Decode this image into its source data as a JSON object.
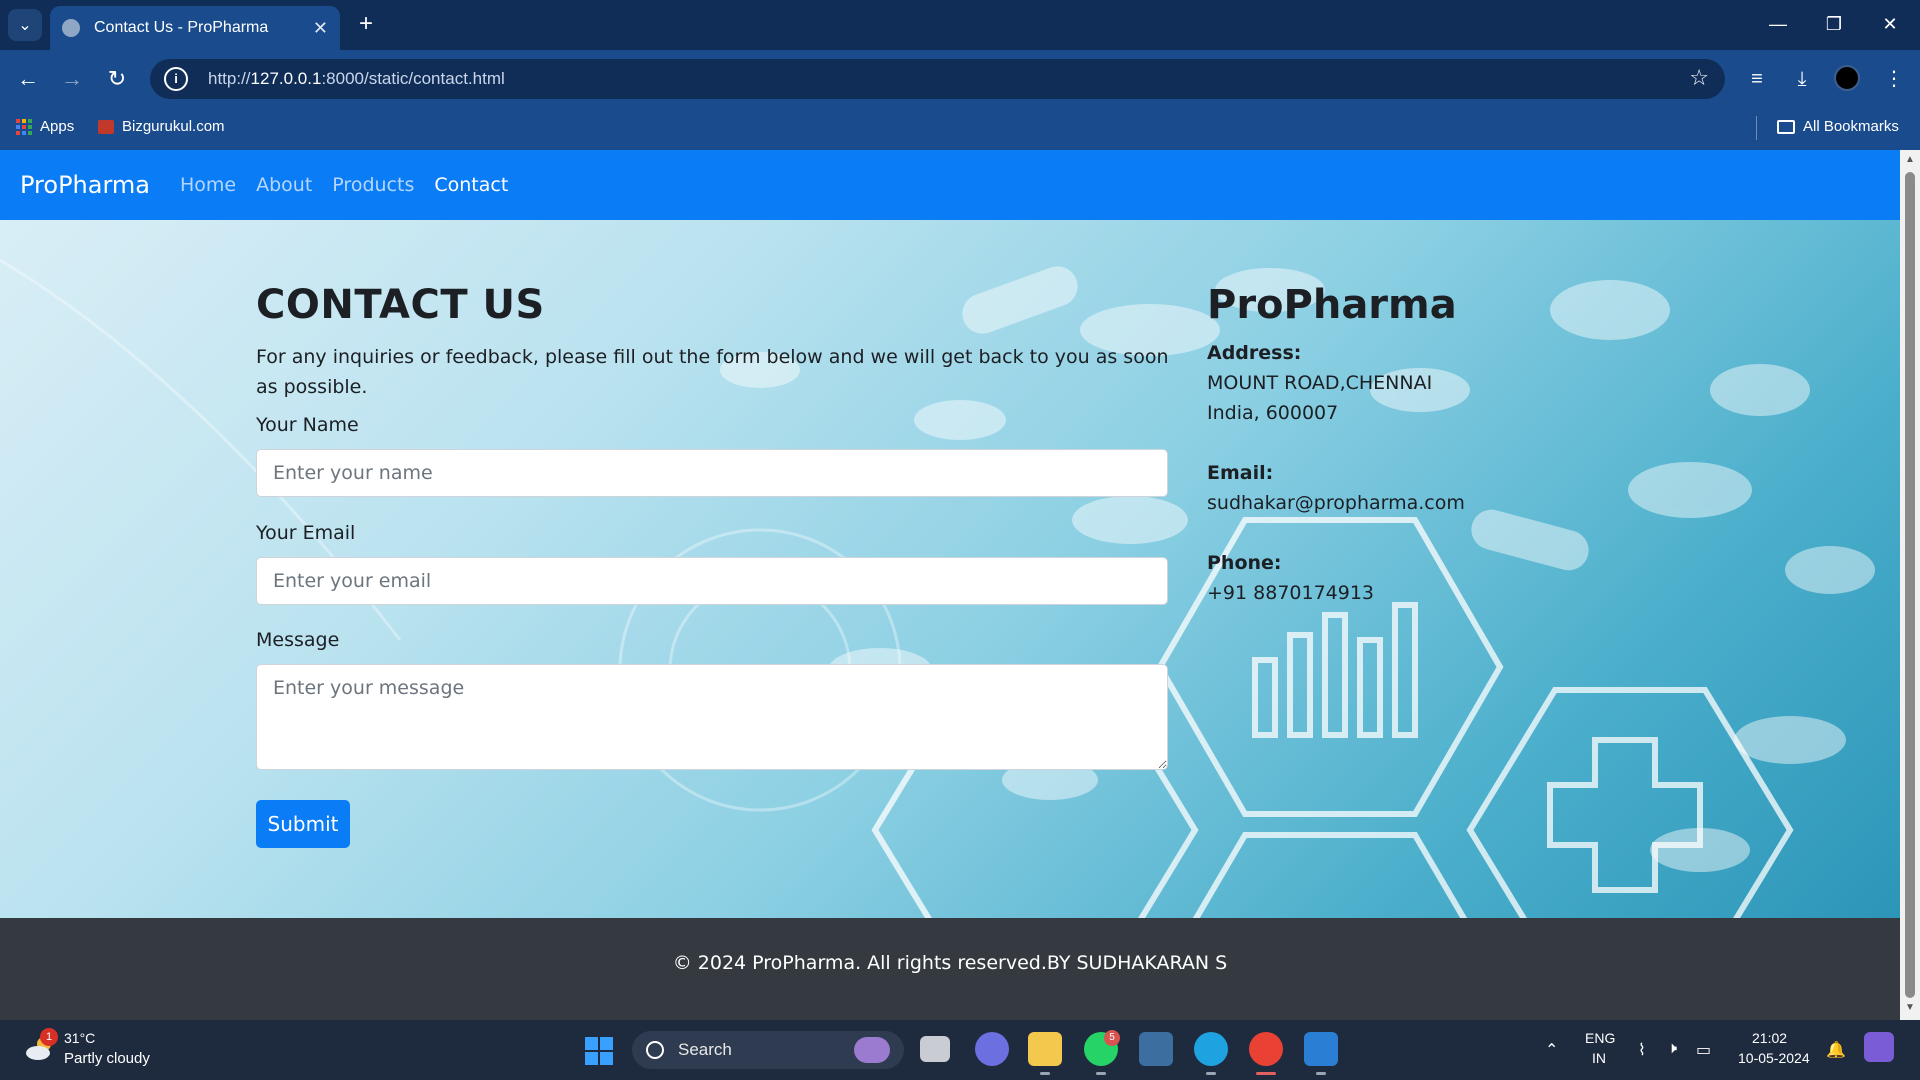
{
  "browser": {
    "tab_title": "Contact Us - ProPharma",
    "new_tab": "+",
    "url_prefix": "http://",
    "url_host": "127.0.0.1",
    "url_rest": ":8000/static/contact.html",
    "bookmarks": [
      {
        "label": "Apps"
      },
      {
        "label": "Bizgurukul.com"
      }
    ],
    "all_bookmarks": "All Bookmarks"
  },
  "navbar": {
    "brand": "ProPharma",
    "links": [
      {
        "label": "Home",
        "active": false
      },
      {
        "label": "About",
        "active": false
      },
      {
        "label": "Products",
        "active": false
      },
      {
        "label": "Contact",
        "active": true
      }
    ]
  },
  "contact": {
    "title": "CONTACT US",
    "intro": "For any inquiries or feedback, please fill out the form below and we will get back to you as soon as possible.",
    "fields": {
      "name": {
        "label": "Your Name",
        "placeholder": "Enter your name",
        "value": ""
      },
      "email": {
        "label": "Your Email",
        "placeholder": "Enter your email",
        "value": ""
      },
      "message": {
        "label": "Message",
        "placeholder": "Enter your message",
        "value": ""
      }
    },
    "submit_label": "Submit"
  },
  "info": {
    "title": "ProPharma",
    "address_label": "Address:",
    "address_line1": "MOUNT ROAD,CHENNAI",
    "address_line2": "India, 600007",
    "email_label": "Email:",
    "email": "sudhakar@propharma.com",
    "phone_label": "Phone:",
    "phone": "+91 8870174913"
  },
  "footer": {
    "text": "© 2024 ProPharma. All rights reserved.BY SUDHAKARAN S"
  },
  "taskbar": {
    "weather_badge": "1",
    "weather_temp": "31°C",
    "weather_desc": "Partly cloudy",
    "search_label": "Search",
    "whatsapp_badge": "5",
    "lang_top": "ENG",
    "lang_bottom": "IN",
    "time": "21:02",
    "date": "10-05-2024"
  },
  "colors": {
    "navbar": "#0a7cf6",
    "footer": "#343a40",
    "submit": "#0a7cf6",
    "browser_frame": "#1a4b8c"
  }
}
